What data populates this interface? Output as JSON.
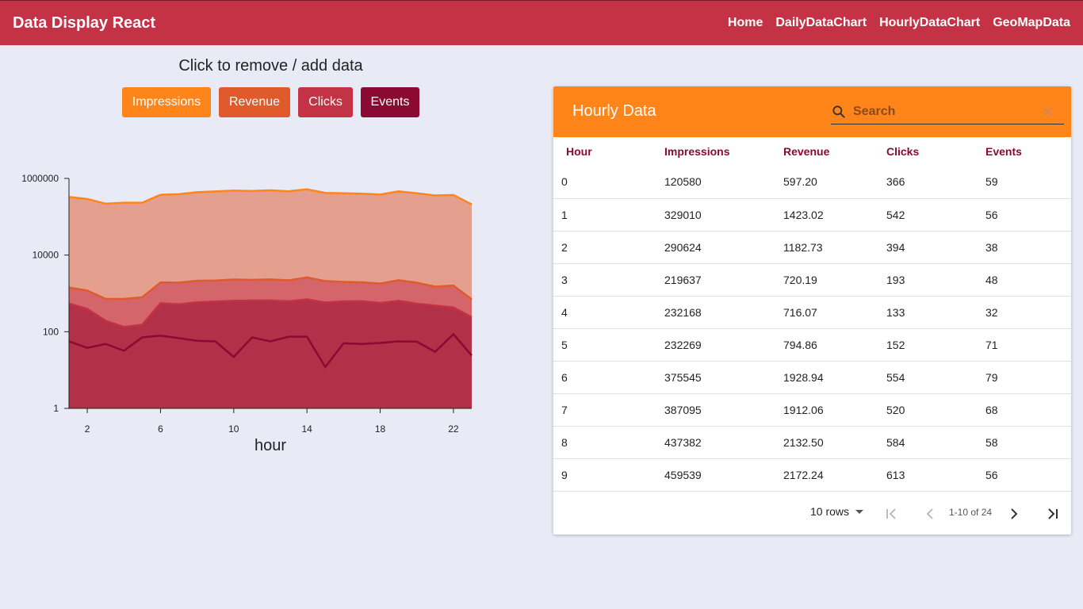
{
  "app": {
    "title": "Data Display React",
    "nav": [
      "Home",
      "DailyDataChart",
      "HourlyDataChart",
      "GeoMapData"
    ]
  },
  "chart_panel": {
    "instruction": "Click to remove / add data",
    "buttons": [
      {
        "label": "Impressions",
        "color": "#ff851b"
      },
      {
        "label": "Revenue",
        "color": "#e05a2c"
      },
      {
        "label": "Clicks",
        "color": "#c33245"
      },
      {
        "label": "Events",
        "color": "#8b0a33"
      }
    ]
  },
  "chart_data": {
    "type": "area",
    "scale": "log",
    "xlabel": "hour",
    "ylabel": "",
    "x": [
      1,
      2,
      3,
      4,
      5,
      6,
      7,
      8,
      9,
      10,
      11,
      12,
      13,
      14,
      15,
      16,
      17,
      18,
      19,
      20,
      21,
      22,
      23
    ],
    "xticks": [
      2,
      6,
      10,
      14,
      18,
      22
    ],
    "yticks": [
      1,
      100,
      10000,
      1000000
    ],
    "ytick_labels": [
      "1",
      "100",
      "10000",
      "1000000"
    ],
    "ylim": [
      1,
      1000000
    ],
    "series": [
      {
        "name": "Impressions",
        "color": "#ff851b",
        "values": [
          329010,
          290624,
          219637,
          232168,
          232269,
          375545,
          387095,
          437382,
          459539,
          480000,
          470000,
          490000,
          460000,
          520000,
          420000,
          410000,
          400000,
          380000,
          460000,
          410000,
          360000,
          370000,
          210000
        ]
      },
      {
        "name": "Revenue",
        "color": "#e05a2c",
        "values": [
          1423.02,
          1182.73,
          720.19,
          716.07,
          794.86,
          1928.94,
          1912.06,
          2132.5,
          2172.24,
          2300,
          2250,
          2320,
          2200,
          2600,
          2100,
          2000,
          1950,
          1800,
          2200,
          1900,
          1500,
          1600,
          700
        ]
      },
      {
        "name": "Clicks",
        "color": "#c33245",
        "values": [
          542,
          394,
          193,
          133,
          152,
          554,
          520,
          584,
          613,
          640,
          650,
          660,
          620,
          700,
          580,
          620,
          630,
          560,
          640,
          540,
          480,
          430,
          240
        ]
      },
      {
        "name": "Events",
        "color": "#8b0a33",
        "values": [
          56,
          38,
          48,
          32,
          71,
          79,
          68,
          58,
          56,
          22,
          71,
          56,
          74,
          74,
          12,
          50,
          48,
          51,
          56,
          55,
          30,
          86,
          24
        ]
      }
    ]
  },
  "table": {
    "title": "Hourly Data",
    "search_placeholder": "Search",
    "columns": [
      "Hour",
      "Impressions",
      "Revenue",
      "Clicks",
      "Events"
    ],
    "rows": [
      [
        "0",
        "120580",
        "597.20",
        "366",
        "59"
      ],
      [
        "1",
        "329010",
        "1423.02",
        "542",
        "56"
      ],
      [
        "2",
        "290624",
        "1182.73",
        "394",
        "38"
      ],
      [
        "3",
        "219637",
        "720.19",
        "193",
        "48"
      ],
      [
        "4",
        "232168",
        "716.07",
        "133",
        "32"
      ],
      [
        "5",
        "232269",
        "794.86",
        "152",
        "71"
      ],
      [
        "6",
        "375545",
        "1928.94",
        "554",
        "79"
      ],
      [
        "7",
        "387095",
        "1912.06",
        "520",
        "68"
      ],
      [
        "8",
        "437382",
        "2132.50",
        "584",
        "58"
      ],
      [
        "9",
        "459539",
        "2172.24",
        "613",
        "56"
      ]
    ],
    "rows_per_page": "10 rows",
    "page_info": "1-10 of 24"
  }
}
